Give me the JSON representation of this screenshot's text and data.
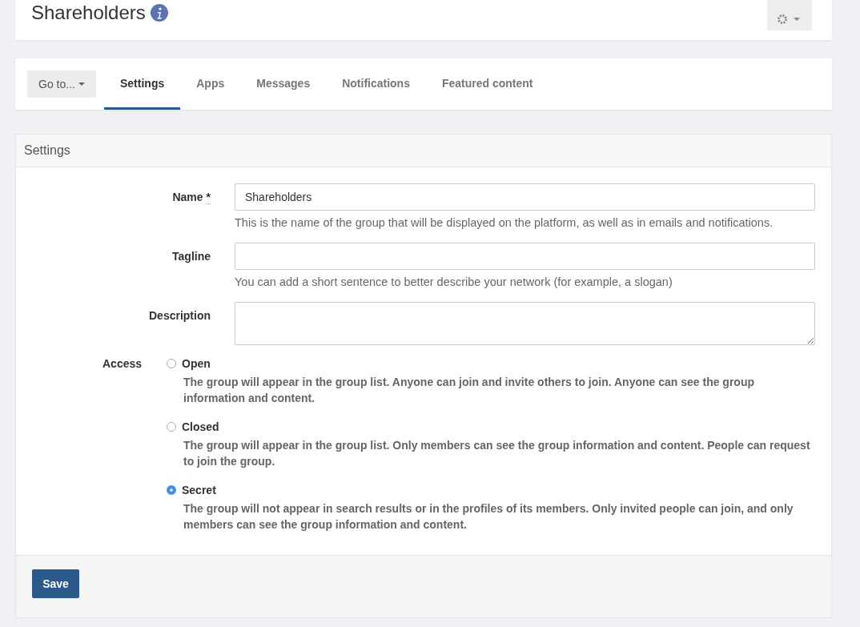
{
  "header": {
    "title": "Shareholders"
  },
  "tabs": [
    {
      "label": "Settings",
      "selected": true
    },
    {
      "label": "Apps",
      "selected": false
    },
    {
      "label": "Messages",
      "selected": false
    },
    {
      "label": "Notifications",
      "selected": false
    },
    {
      "label": "Featured content",
      "selected": false
    }
  ],
  "goto_button": {
    "label": "Go to..."
  },
  "panel": {
    "title": "Settings",
    "fields": [
      {
        "kind": "input",
        "label": "Name",
        "required_mark": "*",
        "value": "Shareholders",
        "help": "This is the name of the group that will be displayed on the platform, as well as in emails and notifications."
      },
      {
        "kind": "input",
        "label": "Tagline",
        "help": "You can add a short sentence to better describe your network (for example, a slogan)"
      },
      {
        "kind": "textarea",
        "label": "Description"
      }
    ],
    "access": {
      "label": "Access",
      "options": [
        {
          "label": "Open",
          "selected": false,
          "description": "The group will appear in the group list. Anyone can join and invite others to join. Anyone can see the group information and content."
        },
        {
          "label": "Closed",
          "selected": false,
          "description": "The group will appear in the group list. Only members can see the group information and content. People can request to join the group."
        },
        {
          "label": "Secret",
          "selected": true,
          "description": "The group will not appear in search results or in the profiles of its members. Only invited people can join, and only members can see the group information and content."
        }
      ]
    },
    "save_button": {
      "label": "Save"
    }
  }
}
